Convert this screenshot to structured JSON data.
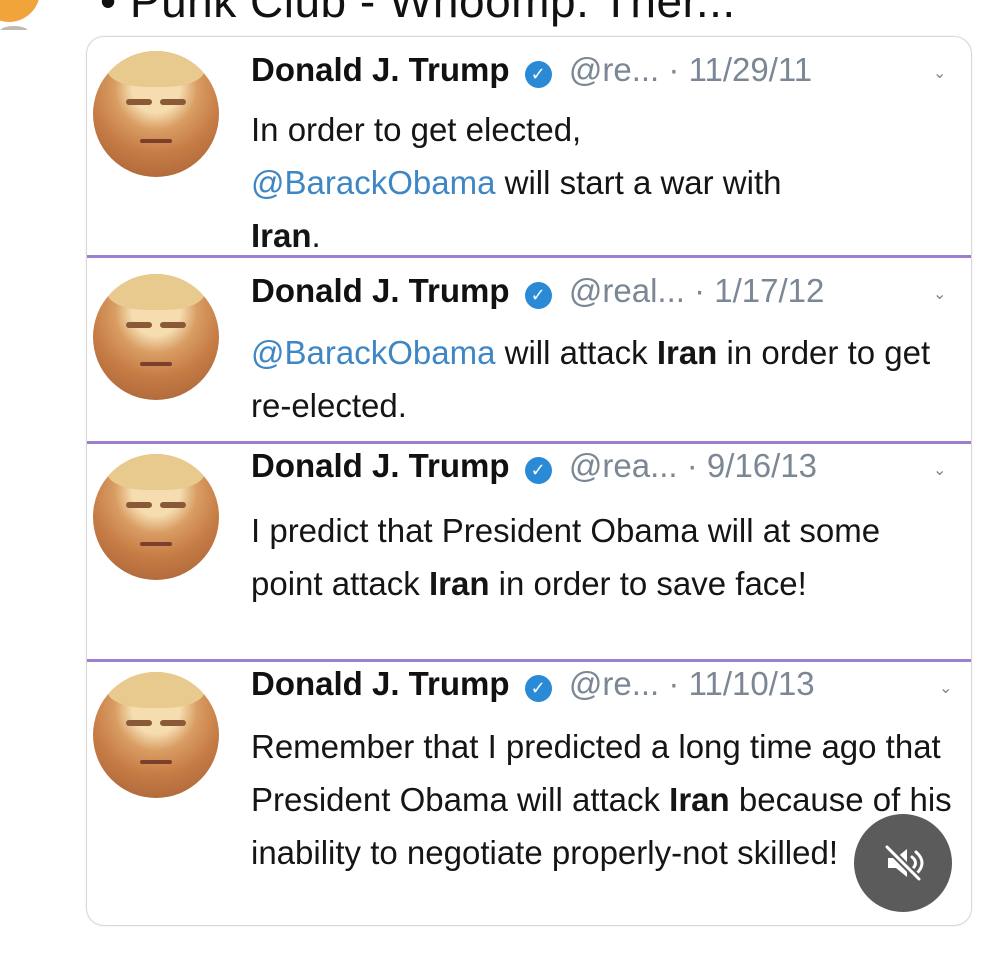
{
  "header": {
    "partial_text": "• Punk Club - Whoomp. Ther..."
  },
  "tweets": [
    {
      "author": "Donald J. Trump",
      "handle": "@re...",
      "separator": "·",
      "date": "11/29/11",
      "body": {
        "p1": "In order to get elected,",
        "mention": "@BarackObama",
        "p2": " will start a war with ",
        "bold": "Iran",
        "p3": "."
      }
    },
    {
      "author": "Donald J. Trump",
      "handle": "@real...",
      "separator": "·",
      "date": "1/17/12",
      "body": {
        "mention": "@BarackObama",
        "p1": " will attack ",
        "bold": "Iran",
        "p2": " in order to get re-elected."
      }
    },
    {
      "author": "Donald J. Trump",
      "handle": "@rea...",
      "separator": "·",
      "date": "9/16/13",
      "body": {
        "p1": "I predict that President Obama will at some point attack ",
        "bold": "Iran",
        "p2": " in order to save face!"
      }
    },
    {
      "author": "Donald J. Trump",
      "handle": "@re...",
      "separator": "·",
      "date": "11/10/13",
      "body": {
        "p1": "Remember that I predicted a long time ago that President Obama will attack ",
        "bold": "Iran",
        "p2": " because of his inability to negotiate properly-not skilled!"
      }
    }
  ],
  "colors": {
    "mention": "#3f87c4",
    "verified": "#2a8ad6",
    "divider": "#9c7fd0",
    "muted_text": "#7b8794"
  },
  "icons": {
    "verified": "verified-badge-icon",
    "caret": "chevron-down-icon",
    "mute": "mute-icon",
    "avatar": "profile-avatar"
  }
}
